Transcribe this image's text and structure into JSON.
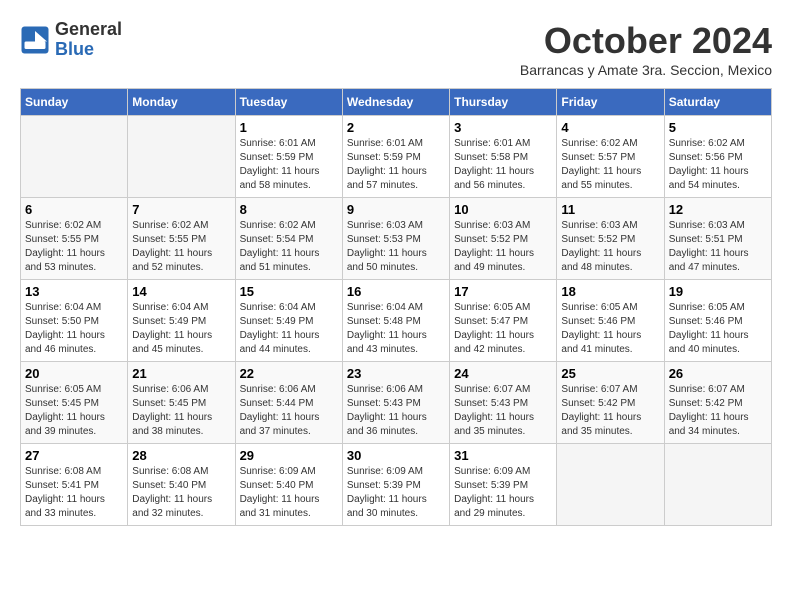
{
  "header": {
    "logo_general": "General",
    "logo_blue": "Blue",
    "title": "October 2024",
    "subtitle": "Barrancas y Amate 3ra. Seccion, Mexico"
  },
  "days_of_week": [
    "Sunday",
    "Monday",
    "Tuesday",
    "Wednesday",
    "Thursday",
    "Friday",
    "Saturday"
  ],
  "weeks": [
    [
      {
        "day": "",
        "info": ""
      },
      {
        "day": "",
        "info": ""
      },
      {
        "day": "1",
        "info": "Sunrise: 6:01 AM\nSunset: 5:59 PM\nDaylight: 11 hours and 58 minutes."
      },
      {
        "day": "2",
        "info": "Sunrise: 6:01 AM\nSunset: 5:59 PM\nDaylight: 11 hours and 57 minutes."
      },
      {
        "day": "3",
        "info": "Sunrise: 6:01 AM\nSunset: 5:58 PM\nDaylight: 11 hours and 56 minutes."
      },
      {
        "day": "4",
        "info": "Sunrise: 6:02 AM\nSunset: 5:57 PM\nDaylight: 11 hours and 55 minutes."
      },
      {
        "day": "5",
        "info": "Sunrise: 6:02 AM\nSunset: 5:56 PM\nDaylight: 11 hours and 54 minutes."
      }
    ],
    [
      {
        "day": "6",
        "info": "Sunrise: 6:02 AM\nSunset: 5:55 PM\nDaylight: 11 hours and 53 minutes."
      },
      {
        "day": "7",
        "info": "Sunrise: 6:02 AM\nSunset: 5:55 PM\nDaylight: 11 hours and 52 minutes."
      },
      {
        "day": "8",
        "info": "Sunrise: 6:02 AM\nSunset: 5:54 PM\nDaylight: 11 hours and 51 minutes."
      },
      {
        "day": "9",
        "info": "Sunrise: 6:03 AM\nSunset: 5:53 PM\nDaylight: 11 hours and 50 minutes."
      },
      {
        "day": "10",
        "info": "Sunrise: 6:03 AM\nSunset: 5:52 PM\nDaylight: 11 hours and 49 minutes."
      },
      {
        "day": "11",
        "info": "Sunrise: 6:03 AM\nSunset: 5:52 PM\nDaylight: 11 hours and 48 minutes."
      },
      {
        "day": "12",
        "info": "Sunrise: 6:03 AM\nSunset: 5:51 PM\nDaylight: 11 hours and 47 minutes."
      }
    ],
    [
      {
        "day": "13",
        "info": "Sunrise: 6:04 AM\nSunset: 5:50 PM\nDaylight: 11 hours and 46 minutes."
      },
      {
        "day": "14",
        "info": "Sunrise: 6:04 AM\nSunset: 5:49 PM\nDaylight: 11 hours and 45 minutes."
      },
      {
        "day": "15",
        "info": "Sunrise: 6:04 AM\nSunset: 5:49 PM\nDaylight: 11 hours and 44 minutes."
      },
      {
        "day": "16",
        "info": "Sunrise: 6:04 AM\nSunset: 5:48 PM\nDaylight: 11 hours and 43 minutes."
      },
      {
        "day": "17",
        "info": "Sunrise: 6:05 AM\nSunset: 5:47 PM\nDaylight: 11 hours and 42 minutes."
      },
      {
        "day": "18",
        "info": "Sunrise: 6:05 AM\nSunset: 5:46 PM\nDaylight: 11 hours and 41 minutes."
      },
      {
        "day": "19",
        "info": "Sunrise: 6:05 AM\nSunset: 5:46 PM\nDaylight: 11 hours and 40 minutes."
      }
    ],
    [
      {
        "day": "20",
        "info": "Sunrise: 6:05 AM\nSunset: 5:45 PM\nDaylight: 11 hours and 39 minutes."
      },
      {
        "day": "21",
        "info": "Sunrise: 6:06 AM\nSunset: 5:45 PM\nDaylight: 11 hours and 38 minutes."
      },
      {
        "day": "22",
        "info": "Sunrise: 6:06 AM\nSunset: 5:44 PM\nDaylight: 11 hours and 37 minutes."
      },
      {
        "day": "23",
        "info": "Sunrise: 6:06 AM\nSunset: 5:43 PM\nDaylight: 11 hours and 36 minutes."
      },
      {
        "day": "24",
        "info": "Sunrise: 6:07 AM\nSunset: 5:43 PM\nDaylight: 11 hours and 35 minutes."
      },
      {
        "day": "25",
        "info": "Sunrise: 6:07 AM\nSunset: 5:42 PM\nDaylight: 11 hours and 35 minutes."
      },
      {
        "day": "26",
        "info": "Sunrise: 6:07 AM\nSunset: 5:42 PM\nDaylight: 11 hours and 34 minutes."
      }
    ],
    [
      {
        "day": "27",
        "info": "Sunrise: 6:08 AM\nSunset: 5:41 PM\nDaylight: 11 hours and 33 minutes."
      },
      {
        "day": "28",
        "info": "Sunrise: 6:08 AM\nSunset: 5:40 PM\nDaylight: 11 hours and 32 minutes."
      },
      {
        "day": "29",
        "info": "Sunrise: 6:09 AM\nSunset: 5:40 PM\nDaylight: 11 hours and 31 minutes."
      },
      {
        "day": "30",
        "info": "Sunrise: 6:09 AM\nSunset: 5:39 PM\nDaylight: 11 hours and 30 minutes."
      },
      {
        "day": "31",
        "info": "Sunrise: 6:09 AM\nSunset: 5:39 PM\nDaylight: 11 hours and 29 minutes."
      },
      {
        "day": "",
        "info": ""
      },
      {
        "day": "",
        "info": ""
      }
    ]
  ]
}
